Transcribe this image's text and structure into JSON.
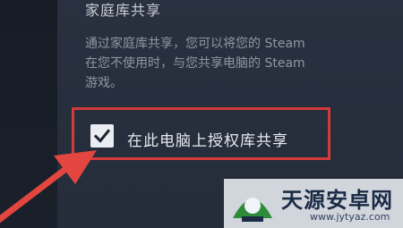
{
  "section": {
    "title": "家庭库共享"
  },
  "description": {
    "line1": "通过家庭库共享，您可以将您的 Steam",
    "line2": "在您不使用时，与您共享电脑的 Steam",
    "line3": "游戏。"
  },
  "option": {
    "label": "在此电脑上授权库共享",
    "checked": true
  },
  "watermark": {
    "name": "天源安卓网",
    "url": "www.jytyaz.com"
  },
  "colors": {
    "highlight": "#d33b3b",
    "arrow": "#e2463f",
    "panel": "#29303f"
  },
  "icons": [
    "checkmark-icon",
    "red-arrow",
    "watermark-logo-icon"
  ]
}
